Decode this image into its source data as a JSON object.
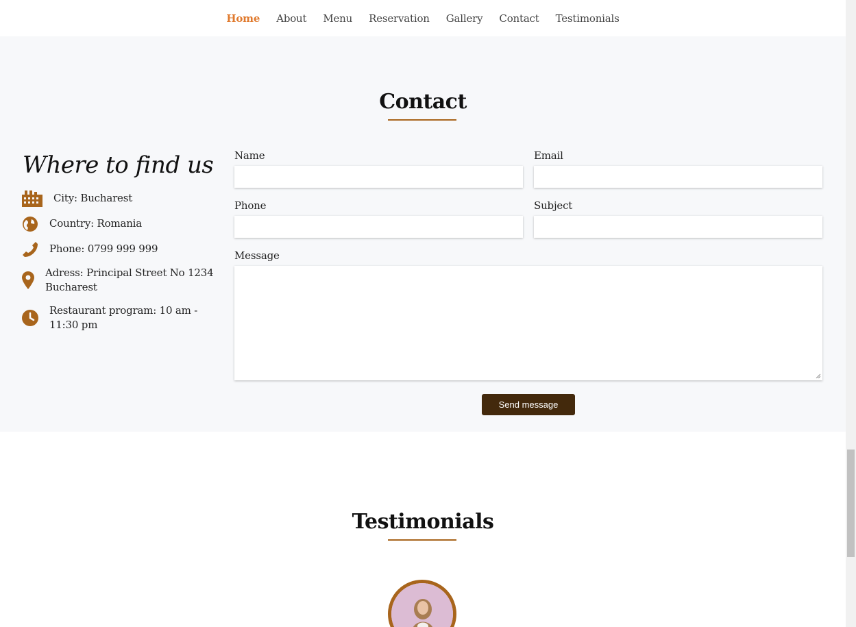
{
  "nav": {
    "items": [
      {
        "label": "Home",
        "active": true
      },
      {
        "label": "About"
      },
      {
        "label": "Menu"
      },
      {
        "label": "Reservation"
      },
      {
        "label": "Gallery"
      },
      {
        "label": "Contact"
      },
      {
        "label": "Testimonials"
      }
    ]
  },
  "contact": {
    "title": "Contact",
    "find_title": "Where to find us",
    "info": [
      {
        "icon": "building-icon",
        "text": "City: Bucharest"
      },
      {
        "icon": "globe-icon",
        "text": "Country: Romania"
      },
      {
        "icon": "phone-icon",
        "text": "Phone: 0799 999 999"
      },
      {
        "icon": "map-pin-icon",
        "text": "Adress: Principal Street No 1234 Bucharest"
      },
      {
        "icon": "clock-icon",
        "text": "Restaurant program: 10 am - 11:30 pm"
      }
    ],
    "form": {
      "name_label": "Name",
      "name_value": "",
      "email_label": "Email",
      "email_value": "",
      "phone_label": "Phone",
      "phone_value": "",
      "subject_label": "Subject",
      "subject_value": "",
      "message_label": "Message",
      "message_value": "",
      "send_label": "Send message"
    }
  },
  "testimonials": {
    "title": "Testimonials"
  },
  "colors": {
    "accent": "#a8651c",
    "nav_active": "#e07a2e",
    "button": "#43290c",
    "section_bg": "#f7f8fa"
  }
}
